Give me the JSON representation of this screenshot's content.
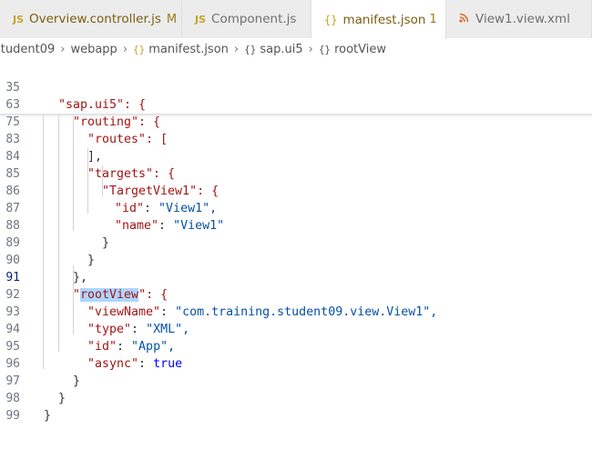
{
  "tabs": [
    {
      "icon": "JS",
      "label": "Overview.controller.js",
      "modified": "M"
    },
    {
      "icon": "JS",
      "label": "Component.js"
    },
    {
      "icon": "{}",
      "label": "manifest.json",
      "count": "1",
      "close": "×"
    },
    {
      "icon": "rss",
      "label": "View1.view.xml"
    }
  ],
  "breadcrumb": {
    "root": "student09",
    "folder": "webapp",
    "file": "manifest.json",
    "node1": "sap.ui5",
    "node2": "rootView"
  },
  "lines": [
    {
      "n": "35",
      "text": "\"sap.ui5\": {"
    },
    {
      "n": "63",
      "text": "\"routing\": {"
    },
    {
      "n": "75",
      "text": "\"routes\": ["
    },
    {
      "n": "83",
      "text": "],"
    },
    {
      "n": "84",
      "text": "\"targets\": {"
    },
    {
      "n": "85",
      "text": "\"TargetView1\": {"
    },
    {
      "n": "86",
      "key": "\"id\"",
      "val": "\"View1\","
    },
    {
      "n": "87",
      "key": "\"name\"",
      "val": "\"View1\""
    },
    {
      "n": "88",
      "text": "}"
    },
    {
      "n": "89",
      "text": "}"
    },
    {
      "n": "90",
      "text": "},"
    },
    {
      "n": "91",
      "text": "\"rootView\": {"
    },
    {
      "n": "92",
      "key": "\"viewName\"",
      "val": "\"com.training.student09.view.View1\","
    },
    {
      "n": "93",
      "key": "\"type\"",
      "val": "\"XML\","
    },
    {
      "n": "94",
      "key": "\"id\"",
      "val": "\"App\","
    },
    {
      "n": "95",
      "key": "\"async\"",
      "val": "true"
    },
    {
      "n": "96",
      "text": "}"
    },
    {
      "n": "97",
      "text": "}"
    },
    {
      "n": "98",
      "text": "}"
    },
    {
      "n": "99",
      "text": ""
    }
  ]
}
